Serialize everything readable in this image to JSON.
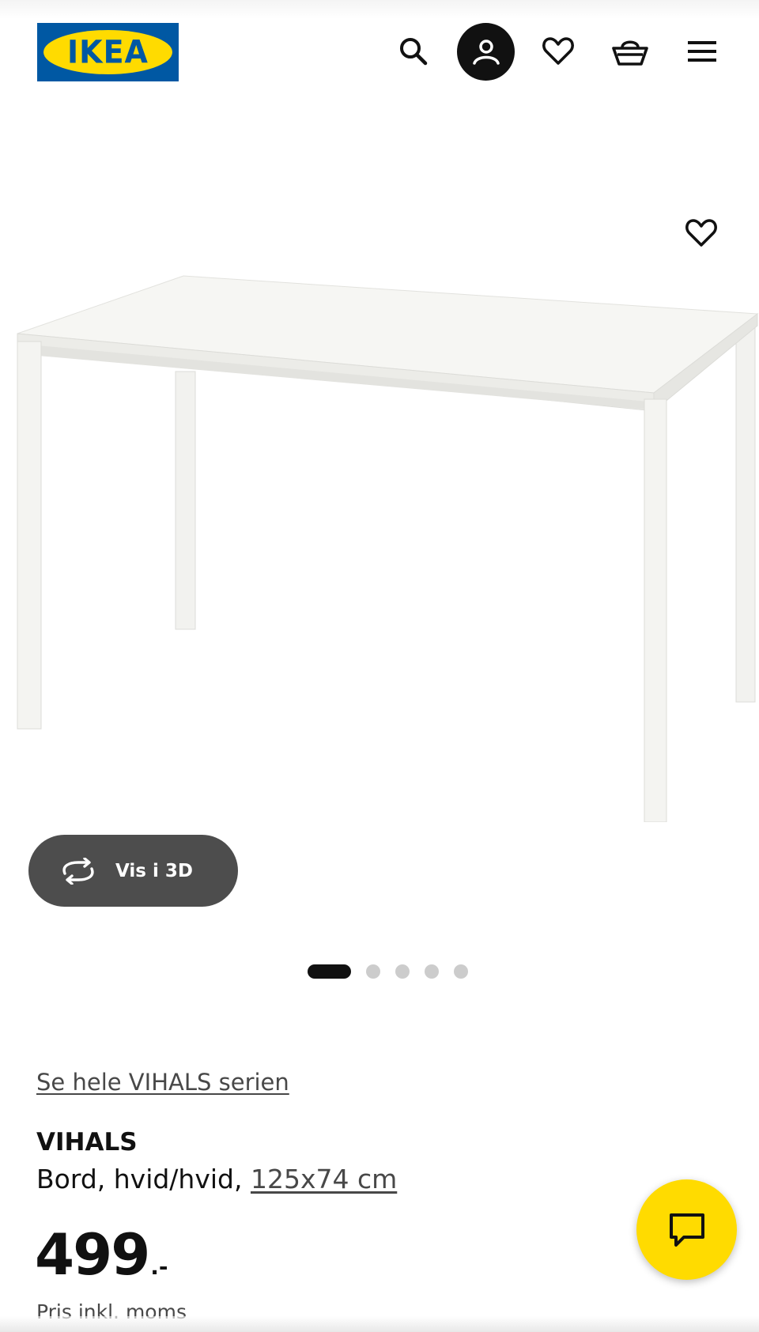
{
  "header": {
    "logo_text": "IKEA",
    "logo_reg": "®",
    "icons": [
      "search-icon",
      "account-icon",
      "heart-icon",
      "basket-icon",
      "menu-icon"
    ]
  },
  "gallery": {
    "view_3d_label": "Vis i 3D",
    "slide_count": 5,
    "active_slide": 1
  },
  "product": {
    "series_link": "Se hele VIHALS serien",
    "name": "VIHALS",
    "description": "Bord, hvid/hvid, ",
    "size_link": "125x74 cm",
    "price_integer": "499",
    "price_suffix": ".-",
    "price_note": "Pris inkl. moms"
  },
  "colors": {
    "brand_blue": "#0058a3",
    "brand_yellow": "#ffdb00",
    "text": "#111111",
    "link": "#484848"
  }
}
